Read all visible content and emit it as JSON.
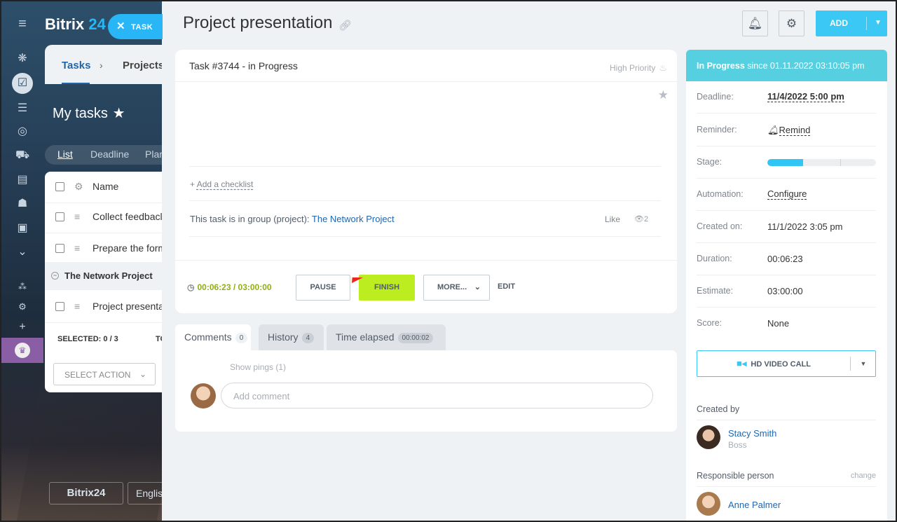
{
  "leftbar": {
    "brand": "Bitrix",
    "brand_num": "24",
    "task_button": "TASK",
    "icons": [
      "menu-icon",
      "activity-icon",
      "tasks-icon",
      "filter-icon",
      "target-icon",
      "cart-icon",
      "contacts-icon",
      "robot-icon",
      "box-icon",
      "more-icon",
      "sitemap-icon",
      "settings-icon",
      "plus-icon",
      "crown-icon"
    ]
  },
  "background": {
    "tab_tasks": "Tasks",
    "tab_projects": "Projects",
    "title": "My tasks",
    "view_list": "List",
    "view_deadline": "Deadline",
    "view_planner": "Plar",
    "col_name": "Name",
    "rows": [
      "Collect feedbacl",
      "Prepare the form"
    ],
    "group": "The Network Project",
    "group_row": "Project presenta",
    "selected": "SELECTED: 0 / 3",
    "to": "TO",
    "select_action": "SELECT ACTION",
    "brand_button": "Bitrix24",
    "lang_button": "English"
  },
  "task": {
    "title": "Project presentation",
    "header": "Task #3744 - in Progress",
    "priority": "High Priority",
    "add_checklist": "Add a checklist",
    "group_text": "This task is in group (project):",
    "group_link": "The Network Project",
    "like": "Like",
    "views": "2",
    "timer": "00:06:23 / 03:00:00",
    "pause": "PAUSE",
    "finish": "FINISH",
    "more": "MORE...",
    "edit": "EDIT"
  },
  "header": {
    "add": "ADD"
  },
  "tabs": {
    "comments": {
      "label": "Comments",
      "count": "0"
    },
    "history": {
      "label": "History",
      "count": "4"
    },
    "time": {
      "label": "Time elapsed",
      "count": "00:00:02"
    }
  },
  "comments": {
    "show_pings": "Show pings (1)",
    "placeholder": "Add comment"
  },
  "sidebar": {
    "status_bold": "In Progress",
    "status_rest": "since 01.11.2022 03:10:05 pm",
    "status_color": "#56d0e0",
    "deadline_label": "Deadline:",
    "deadline_value": "11/4/2022 5:00 pm",
    "reminder_label": "Reminder:",
    "reminder_value": "Remind",
    "stage_label": "Stage:",
    "stage_progress": 0.33,
    "automation_label": "Automation:",
    "automation_value": "Configure",
    "created_label": "Created on:",
    "created_value": "11/1/2022 3:05 pm",
    "duration_label": "Duration:",
    "duration_value": "00:06:23",
    "estimate_label": "Estimate:",
    "estimate_value": "03:00:00",
    "score_label": "Score:",
    "score_value": "None",
    "video_call": "HD VIDEO CALL",
    "created_by_label": "Created by",
    "creator_name": "Stacy Smith",
    "creator_role": "Boss",
    "responsible_label": "Responsible person",
    "change": "change",
    "responsible_name": "Anne Palmer"
  },
  "colors": {
    "accent": "#3bc8f5",
    "finish": "#bbed21",
    "timer": "#8fae1b",
    "link": "#2067b0",
    "annotation_arrow": "#e8291c"
  }
}
